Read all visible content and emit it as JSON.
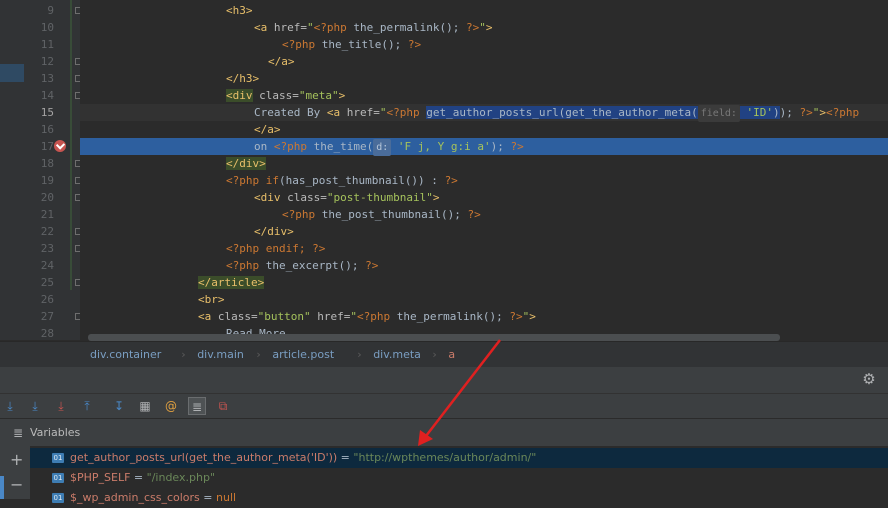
{
  "editor": {
    "line_numbers": [
      "9",
      "10",
      "11",
      "12",
      "13",
      "14",
      "15",
      "16",
      "17",
      "18",
      "19",
      "20",
      "21",
      "22",
      "23",
      "24",
      "25",
      "26",
      "27",
      "28"
    ],
    "current_line": "15",
    "exec_line": "17",
    "code": [
      {
        "id": "l9",
        "indent": 146,
        "parts": [
          {
            "c": "tag",
            "t": "<h3>"
          }
        ]
      },
      {
        "id": "l10",
        "indent": 174,
        "parts": [
          {
            "c": "tag",
            "t": "<a "
          },
          {
            "c": "attr",
            "t": "href="
          },
          {
            "c": "str",
            "t": "\""
          },
          {
            "c": "php",
            "t": "<?php"
          },
          {
            "c": "fn",
            "t": " the_permalink(); "
          },
          {
            "c": "php",
            "t": "?>"
          },
          {
            "c": "str",
            "t": "\""
          },
          {
            "c": "tag",
            "t": ">"
          }
        ]
      },
      {
        "id": "l11",
        "indent": 202,
        "parts": [
          {
            "c": "php",
            "t": "<?php"
          },
          {
            "c": "fn",
            "t": " the_title(); "
          },
          {
            "c": "php",
            "t": "?>"
          }
        ]
      },
      {
        "id": "l12",
        "indent": 188,
        "parts": [
          {
            "c": "tag",
            "t": "</a>"
          }
        ]
      },
      {
        "id": "l13",
        "indent": 146,
        "parts": [
          {
            "c": "tag",
            "t": "</h3>"
          }
        ]
      },
      {
        "id": "l14",
        "indent": 146,
        "parts": [
          {
            "c": "tag box",
            "t": "<div"
          },
          {
            "c": "attr",
            "t": " class="
          },
          {
            "c": "str",
            "t": "\"meta\""
          },
          {
            "c": "tag",
            "t": ">"
          }
        ]
      },
      {
        "id": "l15",
        "indent": 174,
        "parts": [
          {
            "c": "plain",
            "t": "Created By "
          },
          {
            "c": "tag",
            "t": "<a "
          },
          {
            "c": "attr",
            "t": "href="
          },
          {
            "c": "str",
            "t": "\""
          },
          {
            "c": "php",
            "t": "<?php "
          },
          {
            "c": "fn sel-blue",
            "t": "get_author_posts_url(get_the_author_meta("
          },
          {
            "c": "hint",
            "t": "field:"
          },
          {
            "c": "str sel-blue",
            "t": " 'ID'"
          },
          {
            "c": "fn sel-blue",
            "t": ")"
          },
          {
            "c": "fn",
            "t": "); "
          },
          {
            "c": "php",
            "t": "?>"
          },
          {
            "c": "str",
            "t": "\""
          },
          {
            "c": "tag",
            "t": ">"
          },
          {
            "c": "php",
            "t": "<?php"
          }
        ]
      },
      {
        "id": "l16",
        "indent": 174,
        "parts": [
          {
            "c": "tag",
            "t": "</a>"
          }
        ]
      },
      {
        "id": "l17",
        "indent": 174,
        "parts": [
          {
            "c": "plain",
            "t": "on "
          },
          {
            "c": "php",
            "t": "<?php"
          },
          {
            "c": "fn",
            "t": " the_time("
          },
          {
            "c": "hint",
            "t": "d:"
          },
          {
            "c": "str",
            "t": " 'F j, Y g:i a'"
          },
          {
            "c": "fn",
            "t": "); "
          },
          {
            "c": "php",
            "t": "?>"
          }
        ]
      },
      {
        "id": "l18",
        "indent": 146,
        "parts": [
          {
            "c": "tag box",
            "t": "</div>"
          }
        ]
      },
      {
        "id": "l19",
        "indent": 146,
        "parts": [
          {
            "c": "php",
            "t": "<?php if"
          },
          {
            "c": "fn",
            "t": "(has_post_thumbnail()) : "
          },
          {
            "c": "php",
            "t": "?>"
          }
        ]
      },
      {
        "id": "l20",
        "indent": 174,
        "parts": [
          {
            "c": "tag",
            "t": "<div"
          },
          {
            "c": "attr",
            "t": " class="
          },
          {
            "c": "str",
            "t": "\"post-thumbnail\""
          },
          {
            "c": "tag",
            "t": ">"
          }
        ]
      },
      {
        "id": "l21",
        "indent": 202,
        "parts": [
          {
            "c": "php",
            "t": "<?php"
          },
          {
            "c": "fn",
            "t": " the_post_thumbnail(); "
          },
          {
            "c": "php",
            "t": "?>"
          }
        ]
      },
      {
        "id": "l22",
        "indent": 174,
        "parts": [
          {
            "c": "tag",
            "t": "</div>"
          }
        ]
      },
      {
        "id": "l23",
        "indent": 146,
        "parts": [
          {
            "c": "php",
            "t": "<?php endif; ?>"
          }
        ]
      },
      {
        "id": "l24",
        "indent": 146,
        "parts": [
          {
            "c": "php",
            "t": "<?php"
          },
          {
            "c": "fn",
            "t": " the_excerpt(); "
          },
          {
            "c": "php",
            "t": "?>"
          }
        ]
      },
      {
        "id": "l25",
        "indent": 118,
        "parts": [
          {
            "c": "tag box",
            "t": "</article>"
          }
        ]
      },
      {
        "id": "l26",
        "indent": 118,
        "parts": [
          {
            "c": "tag",
            "t": "<br>"
          }
        ]
      },
      {
        "id": "l27",
        "indent": 118,
        "parts": [
          {
            "c": "tag",
            "t": "<a "
          },
          {
            "c": "attr",
            "t": "class="
          },
          {
            "c": "str",
            "t": "\"button\""
          },
          {
            "c": "attr",
            "t": " href="
          },
          {
            "c": "str",
            "t": "\""
          },
          {
            "c": "php",
            "t": "<?php"
          },
          {
            "c": "fn",
            "t": " the_permalink(); "
          },
          {
            "c": "php",
            "t": "?>"
          },
          {
            "c": "str",
            "t": "\""
          },
          {
            "c": "tag",
            "t": ">"
          }
        ]
      },
      {
        "id": "l28",
        "indent": 146,
        "parts": [
          {
            "c": "plain",
            "t": "Read More"
          }
        ]
      }
    ]
  },
  "breadcrumb": [
    "div.container",
    "div.main",
    "article.post",
    "div.meta",
    "a"
  ],
  "toolbar": {
    "icons": [
      "step-over-icon",
      "step-into-icon",
      "force-step-into-icon",
      "step-out-icon",
      "run-to-cursor-icon",
      "evaluate-icon",
      "watch-icon",
      "frames-icon",
      "restore-icon"
    ],
    "glyphs": [
      "⤓",
      "⤓",
      "⤓",
      "⤒",
      "↧",
      "▦",
      "@",
      "≣",
      "⧉"
    ],
    "colors": [
      "#4a88c7",
      "#4a88c7",
      "#c75450",
      "#4a88c7",
      "#4a88c7",
      "#afb1b3",
      "#e0a040",
      "#afb1b3",
      "#c75450"
    ]
  },
  "panel": {
    "gear": "⚙",
    "variables_title": "Variables",
    "variables_icon": "≣",
    "add": "+",
    "remove": "−"
  },
  "variables": [
    {
      "badge": "01",
      "name": "get_author_posts_url(get_the_author_meta('ID'))",
      "eq": " = ",
      "value": "\"http://wpthemes/author/admin/\"",
      "vclass": "vval"
    },
    {
      "badge": "01",
      "name": "$PHP_SELF",
      "eq": " = ",
      "value": "\"/index.php\"",
      "vclass": "vval"
    },
    {
      "badge": "01",
      "name": "$_wp_admin_css_colors",
      "eq": " = ",
      "value": "null",
      "vclass": "vval2"
    }
  ]
}
